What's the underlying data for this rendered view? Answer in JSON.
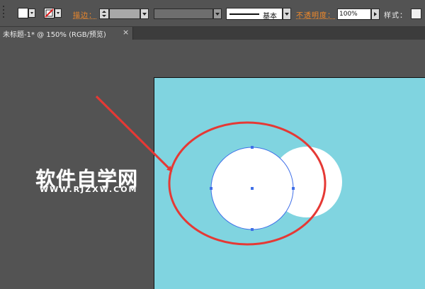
{
  "control_bar": {
    "fill_swatch_color": "#ffffff",
    "stroke_swatch_color": "none",
    "stroke_label": "描边：",
    "brush_profile_label": "基本",
    "opacity_label": "不透明度：",
    "opacity_value": "100%",
    "style_label": "样式："
  },
  "document_tab": {
    "title": "未标题-1* @ 150% (RGB/预览)",
    "close_glyph": "×"
  },
  "canvas": {
    "artboard_color": "#80d4e0",
    "shapes": {
      "back_circle_color": "#ffffff",
      "front_circle_color": "#ffffff",
      "selection_color": "#3f6fe8",
      "highlight_ellipse_color": "#e53935",
      "arrow_color": "#e53935"
    },
    "watermark_text": "软件自学网",
    "watermark_url": "WWW.RJZXW.COM"
  },
  "icons": {
    "stroke_swatch": "no-stroke-icon",
    "grip": "panel-grip-icon"
  }
}
